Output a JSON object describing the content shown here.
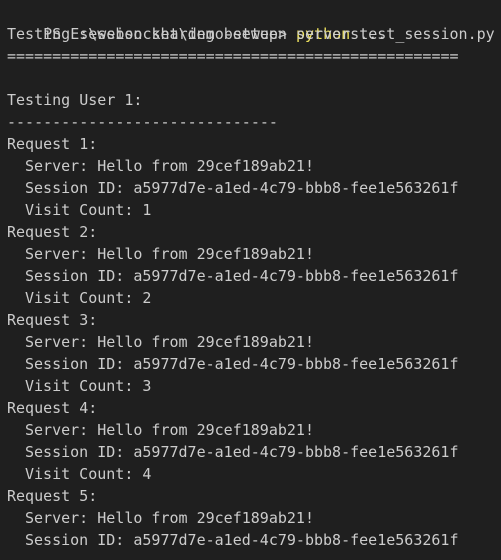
{
  "prompt": {
    "text": "PS E:\\websocket\\demo-setup> ",
    "command": "python",
    "args": " test_session.py"
  },
  "header": {
    "intro": "Testing session sharing between servers...",
    "rule": "=================================================="
  },
  "user_section": {
    "title": "Testing User 1:",
    "rule": "------------------------------"
  },
  "requests": [
    {
      "label": "Request 1:",
      "server": "Server: Hello from 29cef189ab21!",
      "session": "Session ID: a5977d7e-a1ed-4c79-bbb8-fee1e563261f",
      "visit": "Visit Count: 1"
    },
    {
      "label": "Request 2:",
      "server": "Server: Hello from 29cef189ab21!",
      "session": "Session ID: a5977d7e-a1ed-4c79-bbb8-fee1e563261f",
      "visit": "Visit Count: 2"
    },
    {
      "label": "Request 3:",
      "server": "Server: Hello from 29cef189ab21!",
      "session": "Session ID: a5977d7e-a1ed-4c79-bbb8-fee1e563261f",
      "visit": "Visit Count: 3"
    },
    {
      "label": "Request 4:",
      "server": "Server: Hello from 29cef189ab21!",
      "session": "Session ID: a5977d7e-a1ed-4c79-bbb8-fee1e563261f",
      "visit": "Visit Count: 4"
    },
    {
      "label": "Request 5:",
      "server": "Server: Hello from 29cef189ab21!",
      "session": "Session ID: a5977d7e-a1ed-4c79-bbb8-fee1e563261f"
    }
  ],
  "colors": {
    "background": "#1f1f1f",
    "text": "#cccccc",
    "command": "#f0e45f"
  }
}
